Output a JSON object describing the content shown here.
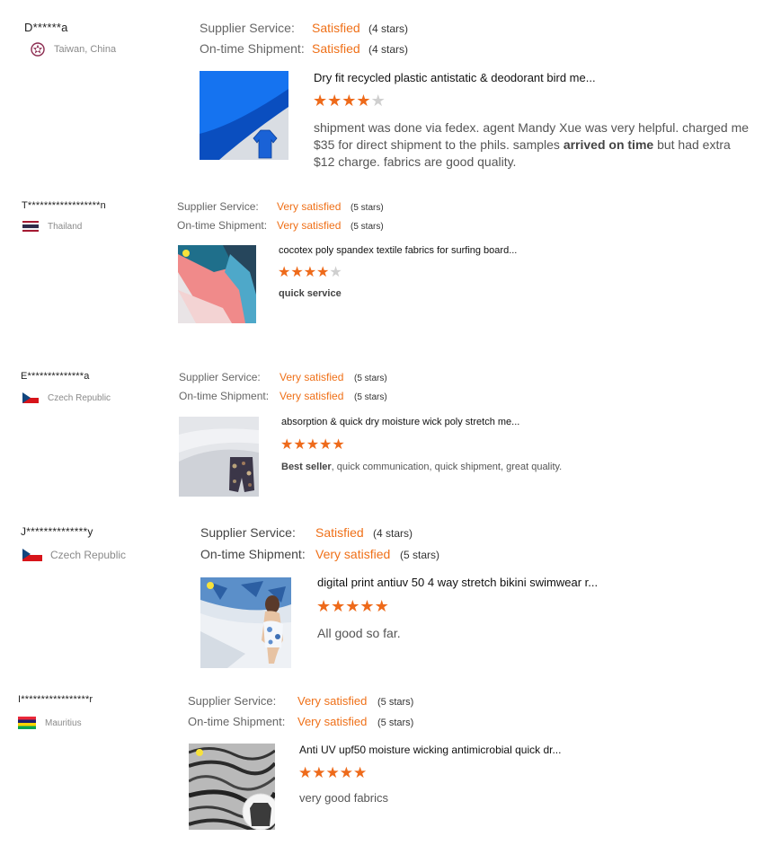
{
  "reviews": [
    {
      "buyer": "D******a",
      "country": "Taiwan, China",
      "flag_icon": "taiwan-emblem-icon",
      "supplier_label": "Supplier Service:",
      "supplier_value": "Satisfied",
      "supplier_stars": "(4 stars)",
      "shipment_label": "On-time Shipment:",
      "shipment_value": "Satisfied",
      "shipment_stars": "(4 stars)",
      "product_title": "Dry fit recycled plastic antistatic & deodorant bird me...",
      "rating": 4,
      "comment_before": "shipment was done via fedex. agent Mandy Xue was very helpful. charged me $35 for direct shipment to the phils. samples ",
      "comment_bold": "arrived on time",
      "comment_after": " but had extra $12  charge. fabrics are good quality."
    },
    {
      "buyer": "T******************n",
      "country": "Thailand",
      "flag_icon": "thailand-flag-icon",
      "supplier_label": "Supplier Service:",
      "supplier_value": "Very satisfied",
      "supplier_stars": "(5 stars)",
      "shipment_label": "On-time Shipment:",
      "shipment_value": "Very satisfied",
      "shipment_stars": "(5 stars)",
      "product_title": "cocotex poly spandex textile fabrics for surfing board...",
      "rating": 4,
      "comment_before": "",
      "comment_bold": "quick service",
      "comment_after": ""
    },
    {
      "buyer": "E**************a",
      "country": "Czech Republic",
      "flag_icon": "czech-flag-icon",
      "supplier_label": "Supplier Service:",
      "supplier_value": "Very satisfied",
      "supplier_stars": "(5 stars)",
      "shipment_label": "On-time Shipment:",
      "shipment_value": "Very satisfied",
      "shipment_stars": "(5 stars)",
      "product_title": "absorption & quick dry moisture wick poly stretch me...",
      "rating": 5,
      "comment_before": "",
      "comment_bold": "Best seller",
      "comment_after": ", quick communication, quick shipment, great quality."
    },
    {
      "buyer": "J**************y",
      "country": "Czech Republic",
      "flag_icon": "czech-flag-icon",
      "supplier_label": "Supplier Service:",
      "supplier_value": "Satisfied",
      "supplier_stars": "(4 stars)",
      "shipment_label": "On-time Shipment:",
      "shipment_value": "Very satisfied",
      "shipment_stars": "(5 stars)",
      "product_title": "digital print antiuv 50 4 way stretch bikini swimwear r...",
      "rating": 5,
      "comment_before": "All good so far.",
      "comment_bold": "",
      "comment_after": ""
    },
    {
      "buyer": "I*****************r",
      "country": "Mauritius",
      "flag_icon": "mauritius-flag-icon",
      "supplier_label": "Supplier Service:",
      "supplier_value": "Very satisfied",
      "supplier_stars": "(5 stars)",
      "shipment_label": "On-time Shipment:",
      "shipment_value": "Very satisfied",
      "shipment_stars": "(5 stars)",
      "product_title": "Anti UV upf50 moisture wicking antimicrobial quick dr...",
      "rating": 5,
      "comment_before": "very good fabrics",
      "comment_bold": "",
      "comment_after": ""
    }
  ]
}
